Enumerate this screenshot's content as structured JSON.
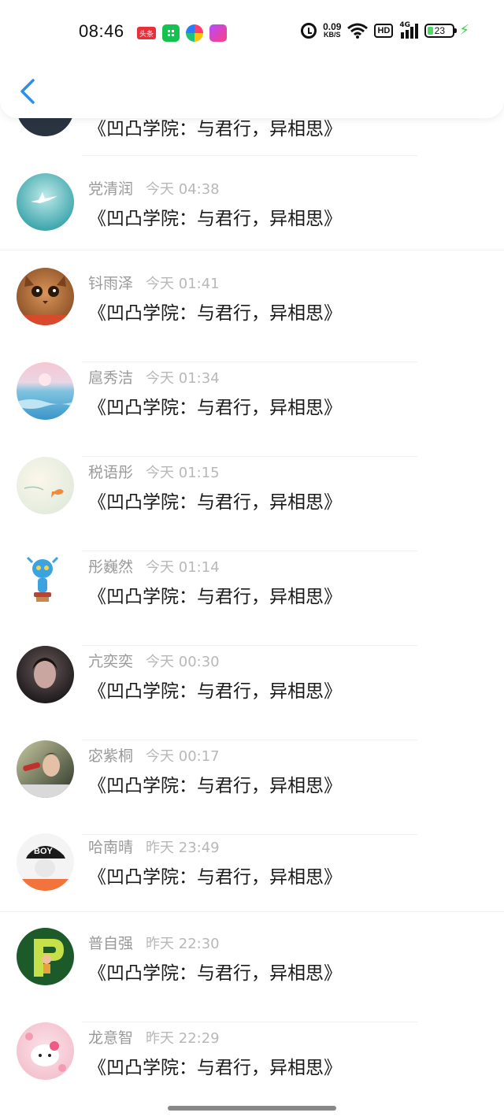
{
  "status_bar": {
    "time": "08:46",
    "toutiao_label": "头条",
    "net_speed_value": "0.09",
    "net_speed_unit": "KB/S",
    "hd_label": "HD",
    "signal_label": "4G",
    "battery_level": "23",
    "battery_percent": 23,
    "icons": [
      "toutiao-icon",
      "mini-program-icon",
      "colorful-app-icon",
      "shop-app-icon",
      "alarm-icon",
      "wifi-icon",
      "signal-icon",
      "battery-icon",
      "charging-icon"
    ]
  },
  "nav": {
    "back_icon": "chevron-left-icon"
  },
  "partial_item": {
    "message": "《凹凸学院：与君行，异相思》"
  },
  "items": [
    {
      "name": "党清润",
      "time": "今天 04:38",
      "message": "《凹凸学院：与君行，异相思》",
      "avatar": "sea-plane"
    },
    {
      "name": "钭雨泽",
      "time": "今天 01:41",
      "message": "《凹凸学院：与君行，异相思》",
      "avatar": "cat"
    },
    {
      "name": "扈秀洁",
      "time": "今天 01:34",
      "message": "《凹凸学院：与君行，异相思》",
      "avatar": "ocean-sunset"
    },
    {
      "name": "税语彤",
      "time": "今天 01:15",
      "message": "《凹凸学院：与君行，异相思》",
      "avatar": "goldfish"
    },
    {
      "name": "彤巍然",
      "time": "今天 01:14",
      "message": "《凹凸学院：与君行，异相思》",
      "avatar": "blue-figurine"
    },
    {
      "name": "亢奕奕",
      "time": "今天 00:30",
      "message": "《凹凸学院：与君行，异相思》",
      "avatar": "portrait-dark"
    },
    {
      "name": "宓紫桐",
      "time": "今天 00:17",
      "message": "《凹凸学院：与君行，异相思》",
      "avatar": "drinking-man"
    },
    {
      "name": "哈南晴",
      "time": "昨天 23:49",
      "message": "《凹凸学院：与君行，异相思》",
      "avatar": "boy-cap"
    },
    {
      "name": "普自强",
      "time": "昨天 22:30",
      "message": "《凹凸学院：与君行，异相思》",
      "avatar": "letter-p"
    },
    {
      "name": "龙意智",
      "time": "昨天 22:29",
      "message": "《凹凸学院：与君行，异相思》",
      "avatar": "hello-kitty"
    }
  ]
}
